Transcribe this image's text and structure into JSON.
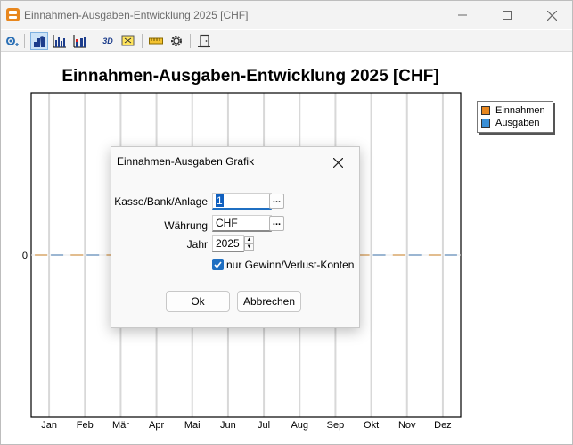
{
  "window": {
    "title": "Einnahmen-Ausgaben-Entwicklung 2025 [CHF]",
    "minimize_label": "—",
    "maximize_label": "☐",
    "close_label": "✕"
  },
  "toolbar": {
    "items": [
      "settings-add-icon",
      "bear-chart-icon",
      "bar-chart-icon",
      "stacked-bar-icon",
      "3d-icon",
      "export-icon",
      "ruler-icon",
      "gear-icon",
      "exit-door-icon"
    ],
    "button_3d_label": "3D"
  },
  "colors": {
    "einnahmen": "#e8871e",
    "ausgaben": "#3a8fd6",
    "accent": "#1f6fc2"
  },
  "chart_data": {
    "type": "bar",
    "title": "Einnahmen-Ausgaben-Entwicklung 2025 [CHF]",
    "categories": [
      "Jan",
      "Feb",
      "Mär",
      "Apr",
      "Mai",
      "Jun",
      "Jul",
      "Aug",
      "Sep",
      "Okt",
      "Nov",
      "Dez"
    ],
    "series": [
      {
        "name": "Einnahmen",
        "values": [
          0,
          0,
          0,
          0,
          0,
          0,
          0,
          0,
          0,
          0,
          0,
          0
        ]
      },
      {
        "name": "Ausgaben",
        "values": [
          0,
          0,
          0,
          0,
          0,
          0,
          0,
          0,
          0,
          0,
          0,
          0
        ]
      }
    ],
    "y_tick_label": "0",
    "grid": true,
    "legend": "top-right"
  },
  "dialog": {
    "title": "Einnahmen-Ausgaben Grafik",
    "close_label": "✕",
    "kasse_label": "Kasse/Bank/Anlage",
    "kasse_value": "1",
    "waehrung_label": "Währung",
    "waehrung_value": "CHF",
    "jahr_label": "Jahr",
    "jahr_value": "2025",
    "dots_label": "...",
    "checkbox_label": "nur Gewinn/Verlust-Konten",
    "ok_label": "Ok",
    "cancel_label": "Abbrechen"
  }
}
